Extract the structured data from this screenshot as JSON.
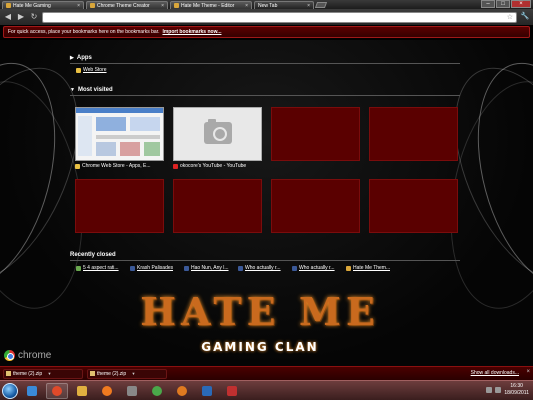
{
  "tabs": [
    {
      "title": "Hate Me Gaming",
      "favicon_color": "#d9a63a",
      "active": false
    },
    {
      "title": "Chrome Theme Creator",
      "favicon_color": "#d9a63a",
      "active": false
    },
    {
      "title": "Hate Me Theme - Editor",
      "favicon_color": "#d9a63a",
      "active": false
    },
    {
      "title": "New Tab",
      "favicon_color": "#d9a63a",
      "active": true
    }
  ],
  "tab_close_glyph": "×",
  "window_controls": {
    "minimize": "–",
    "maximize": "□",
    "close": "×"
  },
  "toolbar": {
    "back_glyph": "◀",
    "forward_glyph": "▶",
    "reload_glyph": "↻",
    "address_value": "",
    "star_glyph": "☆",
    "wrench_glyph": "🔧"
  },
  "bookmarks_bar": {
    "message": "For quick access, place your bookmarks here on the bookmarks bar.",
    "link": "Import bookmarks now..."
  },
  "apps": {
    "heading": "Apps",
    "items": [
      {
        "label": "Web Store",
        "favicon_color": "#e9c043"
      }
    ]
  },
  "most_visited": {
    "heading": "Most visited",
    "tiles": [
      {
        "label": "Chrome Web Store - Apps, E...",
        "favicon_color": "#e9c043",
        "thumb": "store"
      },
      {
        "label": "okocore's YouTube - YouTube",
        "favicon_color": "#d22",
        "thumb": "camera"
      },
      {
        "label": "",
        "thumb": "empty"
      },
      {
        "label": "",
        "thumb": "empty"
      },
      {
        "label": "",
        "thumb": "empty"
      },
      {
        "label": "",
        "thumb": "empty"
      },
      {
        "label": "",
        "thumb": "empty"
      },
      {
        "label": "",
        "thumb": "empty"
      }
    ]
  },
  "recently_closed": {
    "heading": "Recently closed",
    "items": [
      {
        "label": "5 4 aspect rati...",
        "favicon_color": "#6aa84f"
      },
      {
        "label": "Krash Palisades",
        "favicon_color": "#3b5998"
      },
      {
        "label": "Hao Nun, Any l...",
        "favicon_color": "#3b5998"
      },
      {
        "label": "Who actually r...",
        "favicon_color": "#3b5998"
      },
      {
        "label": "Who actually r...",
        "favicon_color": "#3b5998"
      },
      {
        "label": "Hate Me Them...",
        "favicon_color": "#d9a63a"
      }
    ]
  },
  "theme_logo": {
    "title": "HATE ME",
    "subtitle": "GAMING CLAN"
  },
  "brand": {
    "label": "chrome"
  },
  "downloads": {
    "items": [
      {
        "label": "theme (2).zip"
      },
      {
        "label": "theme (2).zip"
      }
    ],
    "show_all": "Show all downloads...",
    "close_glyph": "×"
  },
  "taskbar": {
    "apps": [
      {
        "name": "internet-explorer",
        "color": "#3a8ad8"
      },
      {
        "name": "chrome",
        "color": "#e04a2a"
      },
      {
        "name": "explorer",
        "color": "#e0b040"
      },
      {
        "name": "media-player",
        "color": "#f07a20"
      },
      {
        "name": "steam",
        "color": "#888888"
      },
      {
        "name": "utorrent",
        "color": "#4aa84a"
      },
      {
        "name": "firefox",
        "color": "#e07a20"
      },
      {
        "name": "photoshop",
        "color": "#2a6ab8"
      },
      {
        "name": "winamp",
        "color": "#c03030"
      }
    ],
    "clock_time": "16:30",
    "clock_date": "18/09/2011"
  }
}
